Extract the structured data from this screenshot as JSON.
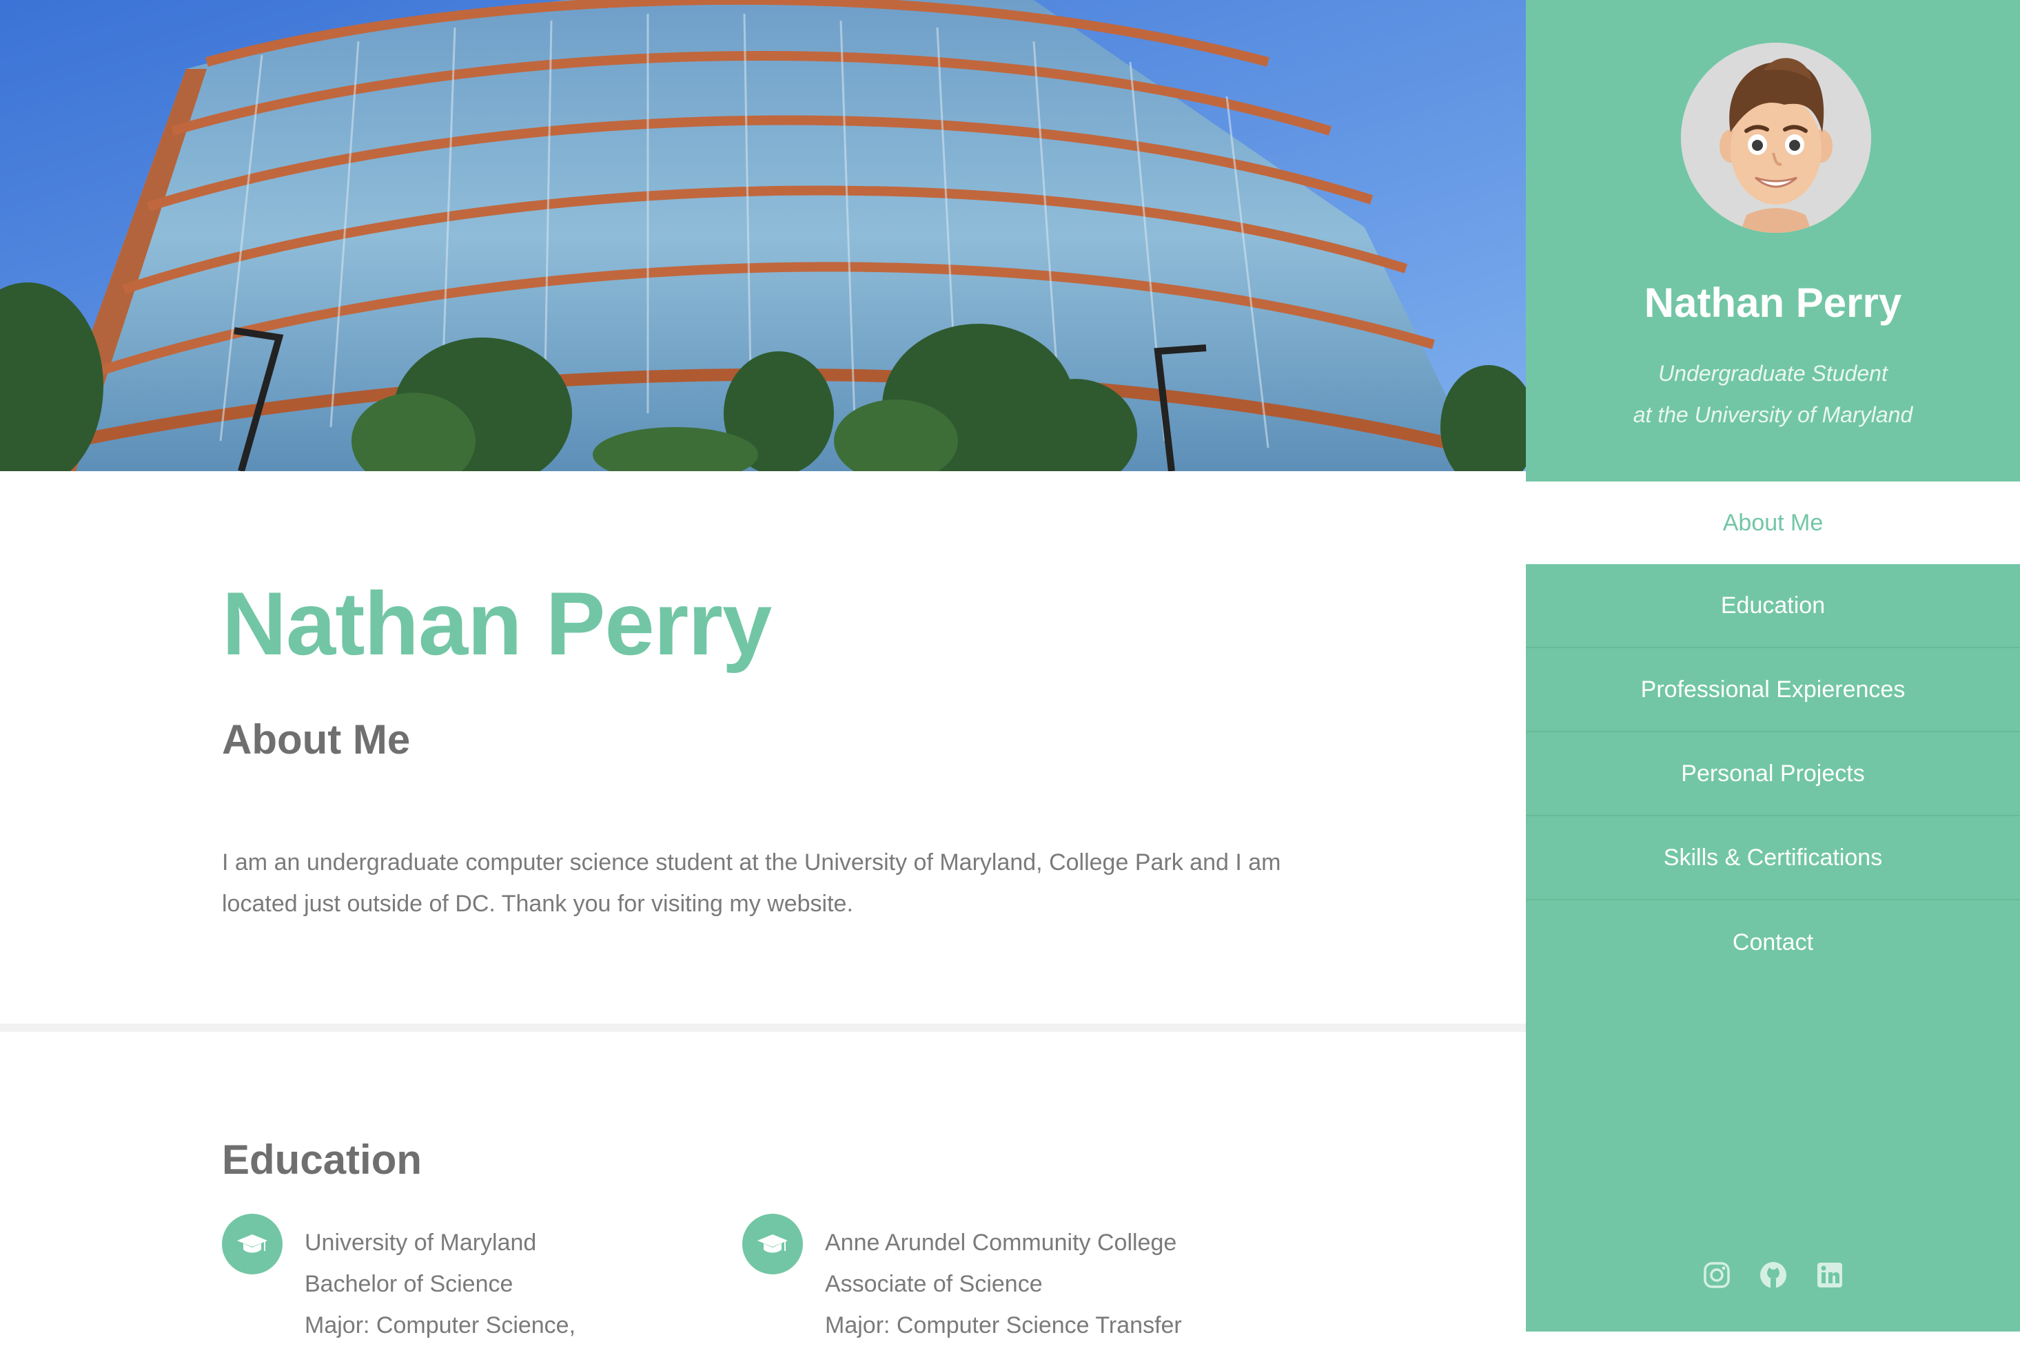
{
  "hero": {
    "image_alt": "Glass building on campus"
  },
  "main": {
    "name": "Nathan Perry",
    "about": {
      "title": "About Me",
      "text": "I am an undergraduate computer science student at the University of Maryland, College Park and I am located just outside of DC. Thank you for visiting my website."
    },
    "education": {
      "title": "Education",
      "items": [
        {
          "icon": "graduation-cap-icon",
          "school": "University of Maryland",
          "degree": "Bachelor of Science",
          "major": "Major: Computer Science,"
        },
        {
          "icon": "graduation-cap-icon",
          "school": "Anne Arundel Community College",
          "degree": "Associate of Science",
          "major": "Major: Computer Science Transfer"
        }
      ]
    }
  },
  "sidebar": {
    "name": "Nathan Perry",
    "subtitle_line1": "Undergraduate Student",
    "subtitle_line2": "at the University of Maryland",
    "nav": [
      {
        "label": "About Me",
        "active": true
      },
      {
        "label": "Education"
      },
      {
        "label": "Professional Expierences"
      },
      {
        "label": "Personal Projects"
      },
      {
        "label": "Skills & Certifications"
      },
      {
        "label": "Contact"
      }
    ],
    "social": [
      "instagram-icon",
      "github-icon",
      "linkedin-icon"
    ]
  },
  "colors": {
    "accent": "#72c6a5",
    "text_gray": "#7a7a7a",
    "heading_gray": "#6f6f6f",
    "sidebar_bg": "#72c6a5"
  }
}
